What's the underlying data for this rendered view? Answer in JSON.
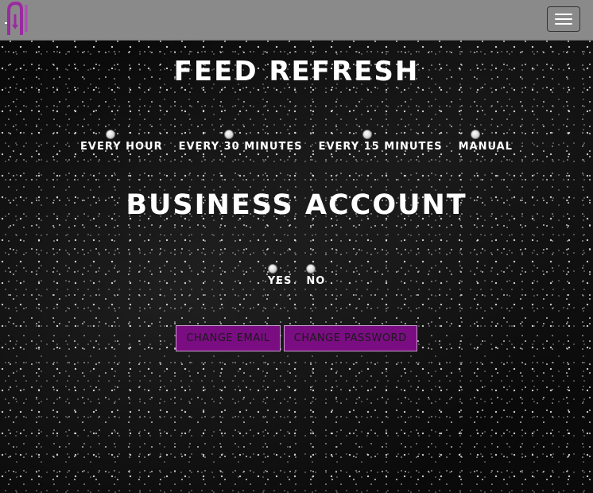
{
  "navbar": {
    "logo_alt": "logo",
    "menu_icon": "hamburger-menu-icon",
    "background_color": "#8a8a8a"
  },
  "feed_refresh": {
    "title": "FEED REFRESH",
    "options": [
      {
        "label": "EVERY HOUR",
        "selected": false
      },
      {
        "label": "EVERY 30 MINUTES",
        "selected": false
      },
      {
        "label": "EVERY 15 MINUTES",
        "selected": false
      },
      {
        "label": "MANUAL",
        "selected": false
      }
    ]
  },
  "business_account": {
    "title": "BUSINESS ACCOUNT",
    "options": [
      {
        "label": "YES",
        "selected": false
      },
      {
        "label": "NO",
        "selected": false
      }
    ]
  },
  "actions": {
    "change_email_label": "CHANGE EMAIL",
    "change_password_label": "CHANGE PASSWORD",
    "button_color": "#7a0d82"
  }
}
